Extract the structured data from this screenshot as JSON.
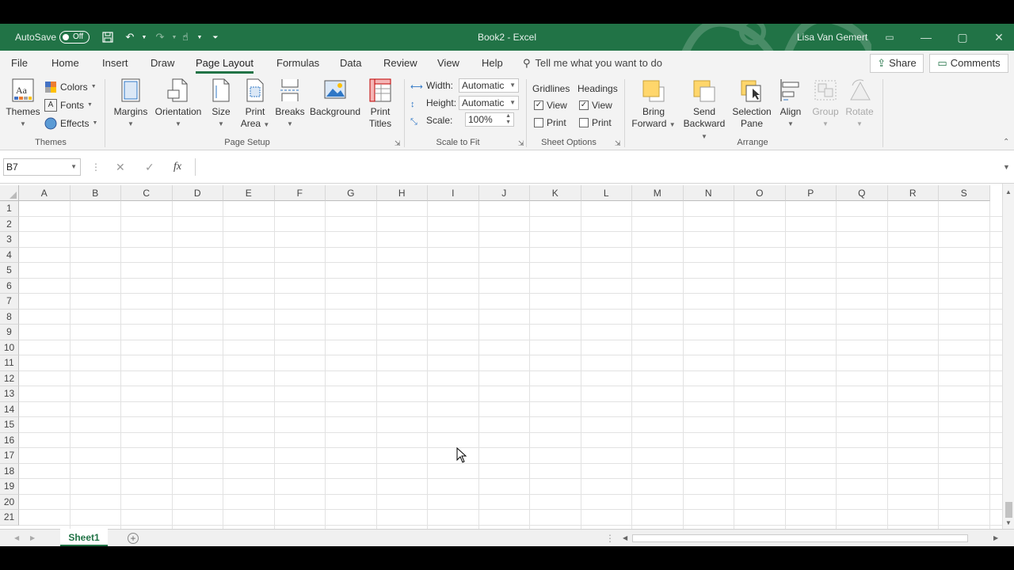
{
  "titlebar": {
    "autosave_label": "AutoSave",
    "autosave_state": "Off",
    "doc_title": "Book2  -  Excel",
    "user_name": "Lisa Van Gemert",
    "accent": "#217346"
  },
  "tabs": {
    "items": [
      "File",
      "Home",
      "Insert",
      "Draw",
      "Page Layout",
      "Formulas",
      "Data",
      "Review",
      "View",
      "Help"
    ],
    "active": "Page Layout",
    "tellme": "Tell me what you want to do",
    "share": "Share",
    "comments": "Comments"
  },
  "ribbon": {
    "themes": {
      "themes_label": "Themes",
      "colors_label": "Colors",
      "fonts_label": "Fonts",
      "effects_label": "Effects",
      "group_label": "Themes"
    },
    "page_setup": {
      "margins": "Margins",
      "orientation": "Orientation",
      "size": "Size",
      "print_area_1": "Print",
      "print_area_2": "Area",
      "breaks": "Breaks",
      "background": "Background",
      "print_titles_1": "Print",
      "print_titles_2": "Titles",
      "group_label": "Page Setup"
    },
    "scale_to_fit": {
      "width_label": "Width:",
      "width_value": "Automatic",
      "height_label": "Height:",
      "height_value": "Automatic",
      "scale_label": "Scale:",
      "scale_value": "100%",
      "group_label": "Scale to Fit"
    },
    "sheet_options": {
      "gridlines": "Gridlines",
      "headings": "Headings",
      "view": "View",
      "print": "Print",
      "group_label": "Sheet Options"
    },
    "arrange": {
      "bring_1": "Bring",
      "bring_2": "Forward",
      "send_1": "Send",
      "send_2": "Backward",
      "selection_1": "Selection",
      "selection_2": "Pane",
      "align": "Align",
      "group": "Group",
      "rotate": "Rotate",
      "group_label": "Arrange"
    }
  },
  "formula_bar": {
    "name_box": "B7",
    "fx": "fx",
    "cancel": "✕",
    "enter": "✓",
    "content": ""
  },
  "grid": {
    "columns": [
      "A",
      "B",
      "C",
      "D",
      "E",
      "F",
      "G",
      "H",
      "I",
      "J",
      "K",
      "L",
      "M",
      "N",
      "O",
      "P",
      "Q",
      "R",
      "S"
    ],
    "rows": [
      "1",
      "2",
      "3",
      "4",
      "5",
      "6",
      "7",
      "8",
      "9",
      "10",
      "11",
      "12",
      "13",
      "14",
      "15",
      "16",
      "17",
      "18",
      "19",
      "20",
      "21"
    ]
  },
  "sheets": {
    "tabs": [
      "Sheet1"
    ],
    "active": "Sheet1"
  }
}
